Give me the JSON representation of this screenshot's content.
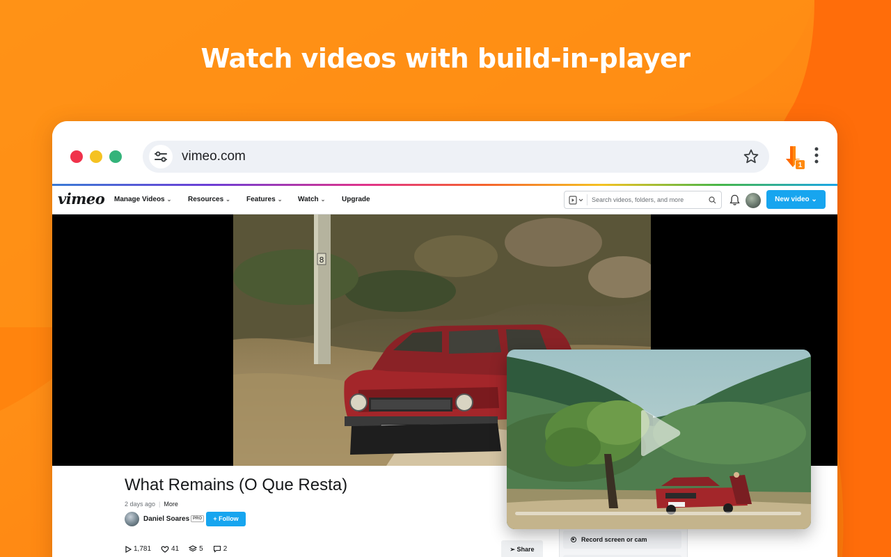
{
  "headline": "Watch videos with build-in-player",
  "browser": {
    "url": "vimeo.com",
    "extension_badge": "1"
  },
  "vimeo": {
    "logo": "vimeo",
    "nav": [
      {
        "label": "Manage Videos",
        "has_dropdown": true
      },
      {
        "label": "Resources",
        "has_dropdown": true
      },
      {
        "label": "Features",
        "has_dropdown": true
      },
      {
        "label": "Watch",
        "has_dropdown": true
      },
      {
        "label": "Upgrade",
        "has_dropdown": false
      }
    ],
    "search_placeholder": "Search videos, folders, and more",
    "new_video_label": "New video"
  },
  "video": {
    "title": "What Remains (O Que Resta)",
    "posted": "2 days ago",
    "more_label": "More",
    "owner": "Daniel Soares",
    "owner_badge": "PRO",
    "follow_label": "+ Follow",
    "stats": {
      "plays": "1,781",
      "likes": "41",
      "collections": "5",
      "comments": "2"
    },
    "share_label": "Share"
  },
  "side_panel": {
    "record_label": "Record screen or cam"
  },
  "mini_player": {
    "progress": 0.0
  },
  "colors": {
    "background": "#ff8a0f",
    "vimeo_blue": "#17a5ef",
    "car_red": "#a3262a"
  }
}
